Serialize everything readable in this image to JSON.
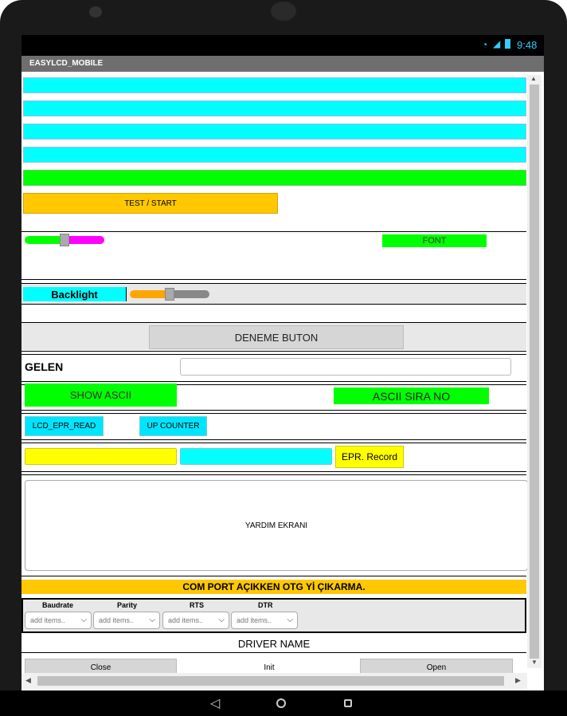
{
  "status": {
    "time": "9:48"
  },
  "app": {
    "title": "EASYLCD_MOBILE"
  },
  "test_button": "TEST / START",
  "font_button": "FONT",
  "backlight_label": "Backlight",
  "deneme_button": "DENEME BUTON",
  "gelen_label": "GELEN",
  "gelen_value": "",
  "show_ascii_button": "SHOW ASCII",
  "ascii_sira_button": "ASCII SIRA NO",
  "lcd_epr_read_button": "LCD_EPR_READ",
  "up_counter_button": "UP COUNTER",
  "epr_record_button": "EPR. Record",
  "help_screen": "YARDIM EKRANI",
  "warning": "COM PORT AÇIKKEN OTG Yİ ÇIKARMA.",
  "serial": {
    "labels": [
      "Baudrate",
      "Parity",
      "RTS",
      "DTR"
    ],
    "placeholder": "add items.."
  },
  "driver_name": "DRIVER NAME",
  "bottom_buttons": {
    "close": "Close",
    "init": "Init",
    "open": "Open"
  },
  "colors": {
    "cyan": "#00ffff",
    "green": "#00ff00",
    "orange": "#ffc800",
    "yellow": "#ffff00",
    "magenta": "#ff00ff"
  },
  "sliders": {
    "font_slider_value": 0.5,
    "backlight_slider_value": 0.5
  }
}
